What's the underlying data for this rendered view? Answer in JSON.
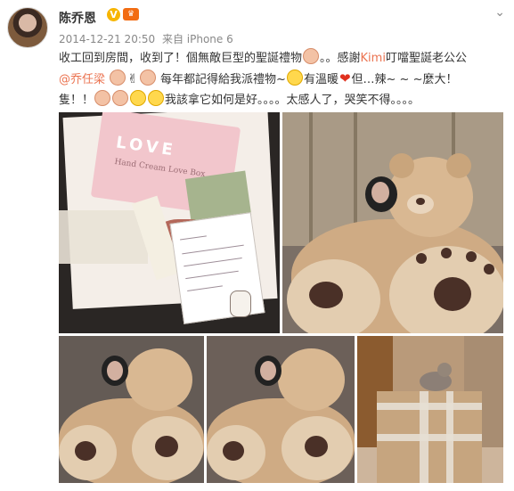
{
  "user": {
    "name": "陈乔恩",
    "verified_badge": "V",
    "member_icon": "vip-crown-icon"
  },
  "meta": {
    "timestamp": "2014-12-21 20:50",
    "source": "来自 iPhone 6"
  },
  "menu_icon": "chevron-down-icon",
  "post": {
    "line1_a": "收工回到房間，收到了！個無敵巨型的聖誕禮物",
    "line1_b": "。。感謝",
    "kimi": "Kimi",
    "line1_c": "叮噹聖誕老公公",
    "mention": "@乔任梁",
    "line2_a": "每年都記得給我派禮物~",
    "line2_b": "有溫暖",
    "line2_c": "但…辣~ ~ ~麼大！",
    "line3_a": "隻！！",
    "line3_b": "我該拿它如何是好。。。。太感人了，哭笑不得。。。。"
  },
  "photos": {
    "photo1_card_title": "LOVE",
    "photo1_card_subtitle": "Hand Cream Love Box"
  },
  "colors": {
    "link": "#eb7350",
    "text": "#333333",
    "meta": "#888888"
  }
}
